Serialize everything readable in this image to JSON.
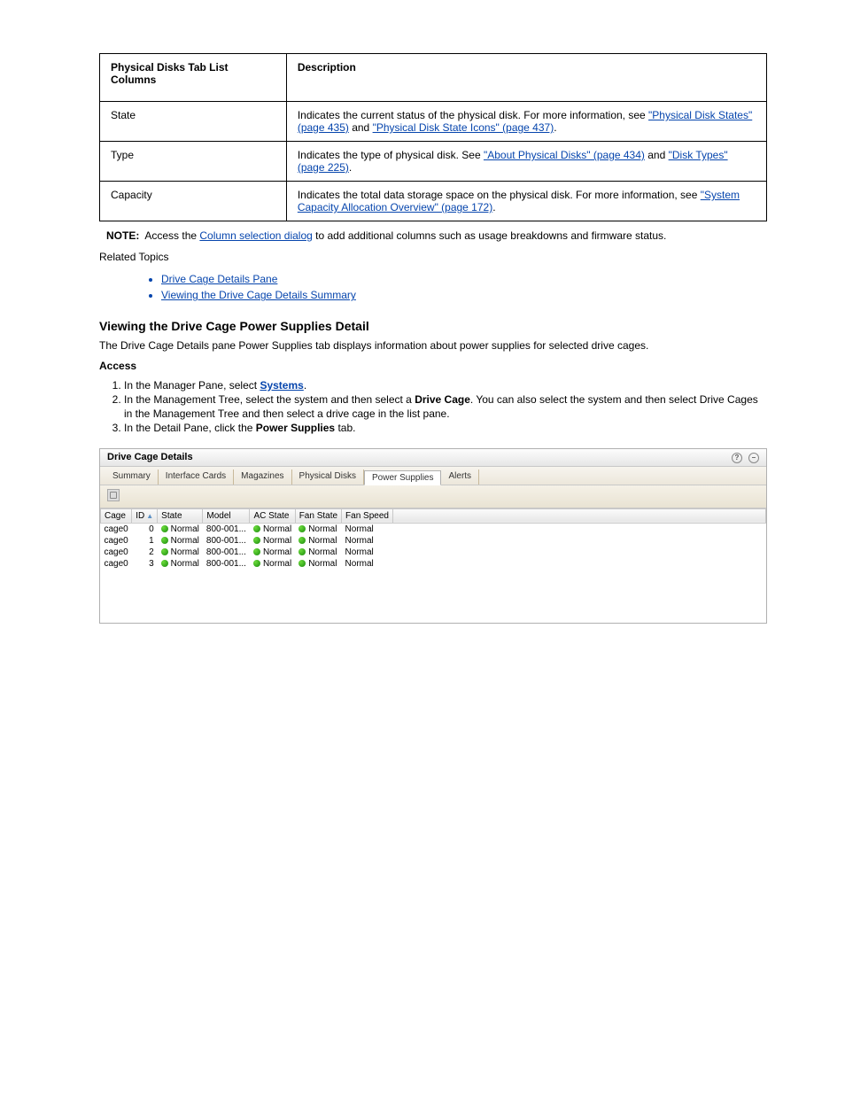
{
  "table1": {
    "headers": [
      "Physical Disks Tab List Columns",
      "Description"
    ],
    "rows": [
      {
        "col": "State",
        "desc_prefix": "Indicates the current status of the physical disk. For more information, see ",
        "link1": "\"Physical Disk States\" (page 435)",
        "mid": " and ",
        "link2": "\"Physical Disk State Icons\" (page 437)",
        "suffix": "."
      },
      {
        "col": "Type",
        "desc_prefix": "Indicates the type of physical disk. See ",
        "link1": "\"About Physical Disks\" (page 434)",
        "mid": " and ",
        "link2": "\"Disk Types\" (page 225)",
        "suffix": "."
      },
      {
        "col": "Capacity",
        "desc_prefix": "Indicates the total data storage space on the physical disk. For more information, see ",
        "link1": "\"System Capacity Allocation Overview\" (page 172)",
        "mid": "",
        "link2": "",
        "suffix": "."
      }
    ]
  },
  "note_label": "NOTE:",
  "note_text": "Access the ",
  "note_link": "Column selection dialog",
  "note_tail": " to add additional columns such as usage breakdowns and firmware status.",
  "related_heading": "Related Topics",
  "related": [
    "Drive Cage Details Pane",
    "Viewing the Drive Cage Details Summary"
  ],
  "section_title": "Viewing the Drive Cage Power Supplies Detail",
  "para1": "The Drive Cage Details pane Power Supplies tab displays information about power supplies for selected drive cages.",
  "access_heading": "Access",
  "bullet1_prefix": "In the Manager Pane, select ",
  "bullet1_bold": "Systems",
  "bullet1_suffix": ".",
  "bullet2_prefix": "In the Management Tree, select the system and then select a ",
  "bullet2_bold": "Drive Cage",
  "bullet2_suffix": ". You can also select the system and then select Drive Cages in the Management Tree and then select a drive cage in the list pane.",
  "bullet3_prefix": "In the Detail Pane, click the ",
  "bullet3_bold": "Power Supplies",
  "bullet3_suffix": " tab.",
  "widget": {
    "title": "Drive Cage Details",
    "tabs": [
      "Summary",
      "Interface Cards",
      "Magazines",
      "Physical Disks",
      "Power Supplies",
      "Alerts"
    ],
    "active_tab": 4,
    "columns": [
      "Cage",
      "ID",
      "State",
      "Model",
      "AC State",
      "Fan State",
      "Fan Speed"
    ],
    "rows": [
      {
        "cage": "cage0",
        "id": "0",
        "state": "Normal",
        "model": "800-001...",
        "ac": "Normal",
        "fan": "Normal",
        "speed": "Normal"
      },
      {
        "cage": "cage0",
        "id": "1",
        "state": "Normal",
        "model": "800-001...",
        "ac": "Normal",
        "fan": "Normal",
        "speed": "Normal"
      },
      {
        "cage": "cage0",
        "id": "2",
        "state": "Normal",
        "model": "800-001...",
        "ac": "Normal",
        "fan": "Normal",
        "speed": "Normal"
      },
      {
        "cage": "cage0",
        "id": "3",
        "state": "Normal",
        "model": "800-001...",
        "ac": "Normal",
        "fan": "Normal",
        "speed": "Normal"
      }
    ]
  }
}
